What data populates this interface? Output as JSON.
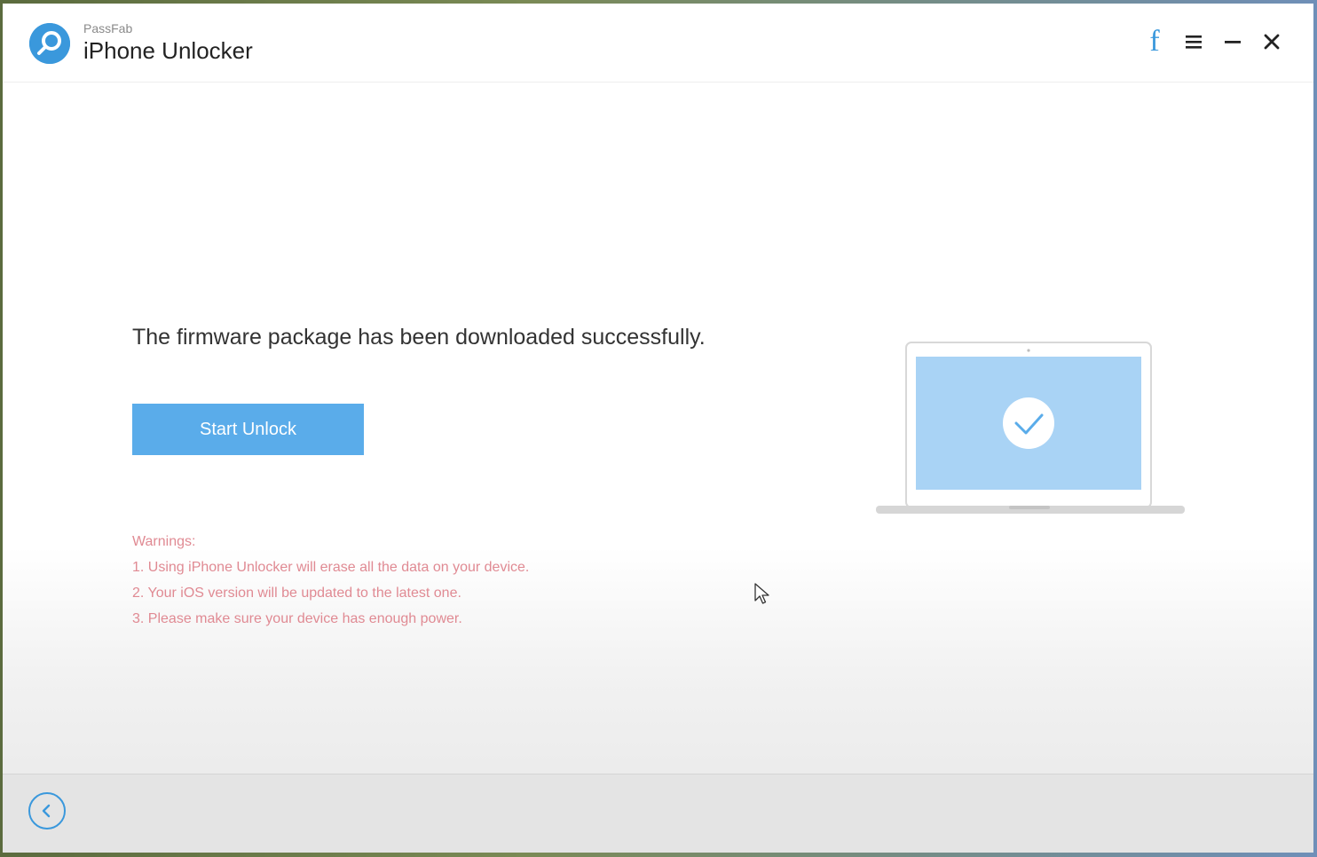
{
  "app": {
    "brand": "PassFab",
    "title": "iPhone Unlocker"
  },
  "titlebar": {
    "icons": [
      "facebook-icon",
      "menu-icon",
      "minimize-icon",
      "close-icon"
    ],
    "facebook_glyph": "f"
  },
  "main": {
    "message": "The firmware package has been downloaded successfully.",
    "start_button": "Start Unlock",
    "warnings": {
      "heading": "Warnings:",
      "items": [
        "1. Using iPhone Unlocker will erase all the data on your device.",
        "2. Your iOS version will be updated to the latest one.",
        "3. Please make sure your device has enough power."
      ]
    },
    "illustration": "laptop-check-icon"
  },
  "footer": {
    "back_icon": "back-arrow-icon"
  },
  "colors": {
    "accent": "#3a98dc",
    "button": "#5aacea",
    "warning": "#e08a93",
    "screen": "#a9d3f5"
  }
}
